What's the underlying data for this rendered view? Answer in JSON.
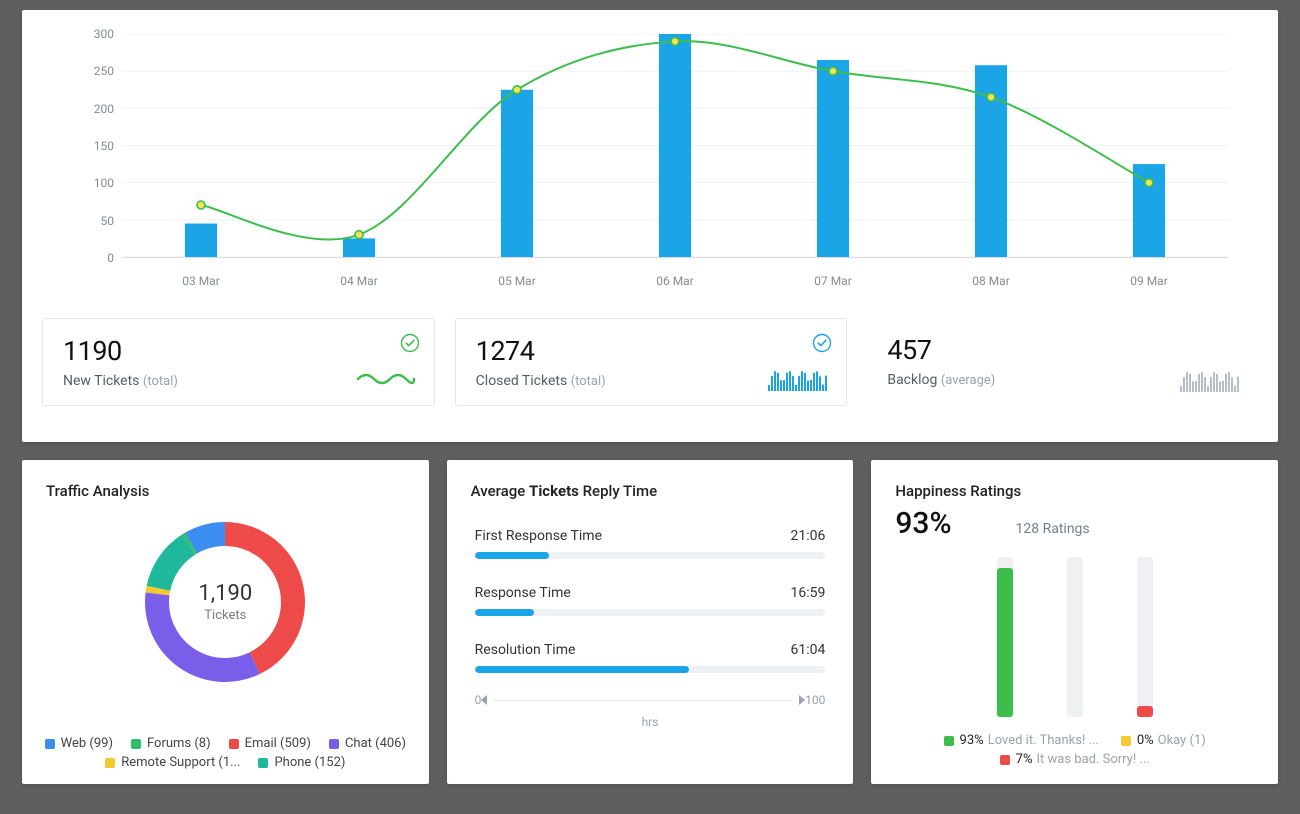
{
  "colors": {
    "bar": "#1ca5e6",
    "line": "#3dbd4b",
    "grey": "#b7bdc5"
  },
  "chart_data": [
    {
      "type": "bar+line",
      "title": "",
      "xlabel": "",
      "ylabel": "",
      "ylim": [
        0,
        300
      ],
      "yticks": [
        0,
        50,
        100,
        150,
        200,
        250,
        300
      ],
      "categories": [
        "03 Mar",
        "04 Mar",
        "05 Mar",
        "06 Mar",
        "07 Mar",
        "08 Mar",
        "09 Mar"
      ],
      "series": [
        {
          "name": "bars",
          "kind": "bar",
          "values": [
            45,
            25,
            225,
            300,
            265,
            258,
            125
          ]
        },
        {
          "name": "line",
          "kind": "line",
          "values": [
            70,
            30,
            225,
            290,
            250,
            215,
            100
          ]
        }
      ]
    },
    {
      "type": "donut",
      "title": "Traffic Analysis",
      "center_value": "1,190",
      "center_label": "Tickets",
      "series": [
        {
          "name": "Web",
          "value": 99,
          "label": "Web (99)",
          "color": "#3d8ef2"
        },
        {
          "name": "Forums",
          "value": 8,
          "label": "Forums (8)",
          "color": "#2fbf6b"
        },
        {
          "name": "Email",
          "value": 509,
          "label": "Email (509)",
          "color": "#ee4a49"
        },
        {
          "name": "Chat",
          "value": 406,
          "label": "Chat (406)",
          "color": "#7a5de8"
        },
        {
          "name": "Remote Support",
          "value": 16,
          "label": "Remote Support (1...",
          "color": "#f5c731"
        },
        {
          "name": "Phone",
          "value": 152,
          "label": "Phone (152)",
          "color": "#1fb89a"
        }
      ]
    },
    {
      "type": "hbar",
      "title": "Average Tickets Reply Time",
      "xlim": [
        0,
        100
      ],
      "xlabel": "hrs",
      "series": [
        {
          "name": "First Response Time",
          "value": 21.1,
          "display": "21:06"
        },
        {
          "name": "Response Time",
          "value": 17.0,
          "display": "16:59"
        },
        {
          "name": "Resolution Time",
          "value": 61.07,
          "display": "61:04"
        }
      ]
    },
    {
      "type": "bar",
      "title": "Happiness Ratings",
      "headline_pct": "93%",
      "ratings_count": "128 Ratings",
      "ylim": [
        0,
        100
      ],
      "series": [
        {
          "name": "Loved it. Thanks! ...",
          "pct": 93,
          "display": "93%",
          "color": "#3dbd4b"
        },
        {
          "name": "Okay (1)",
          "pct": 0,
          "display": "0%",
          "color": "#f5c731"
        },
        {
          "name": "It was bad. Sorry! ...",
          "pct": 7,
          "display": "7%",
          "color": "#ee4a49"
        }
      ]
    }
  ],
  "stats": [
    {
      "value": "1190",
      "label": "New Tickets",
      "suffix": "(total)",
      "badge": "check-green",
      "spark": "wave-green"
    },
    {
      "value": "1274",
      "label": "Closed  Tickets",
      "suffix": "(total)",
      "badge": "check-blue",
      "spark": "bars-blue"
    },
    {
      "value": "457",
      "label": "Backlog",
      "suffix": "(average)",
      "badge": "",
      "spark": "bars-grey"
    }
  ],
  "scale": {
    "min": "0",
    "max": "100",
    "unit": "hrs"
  }
}
